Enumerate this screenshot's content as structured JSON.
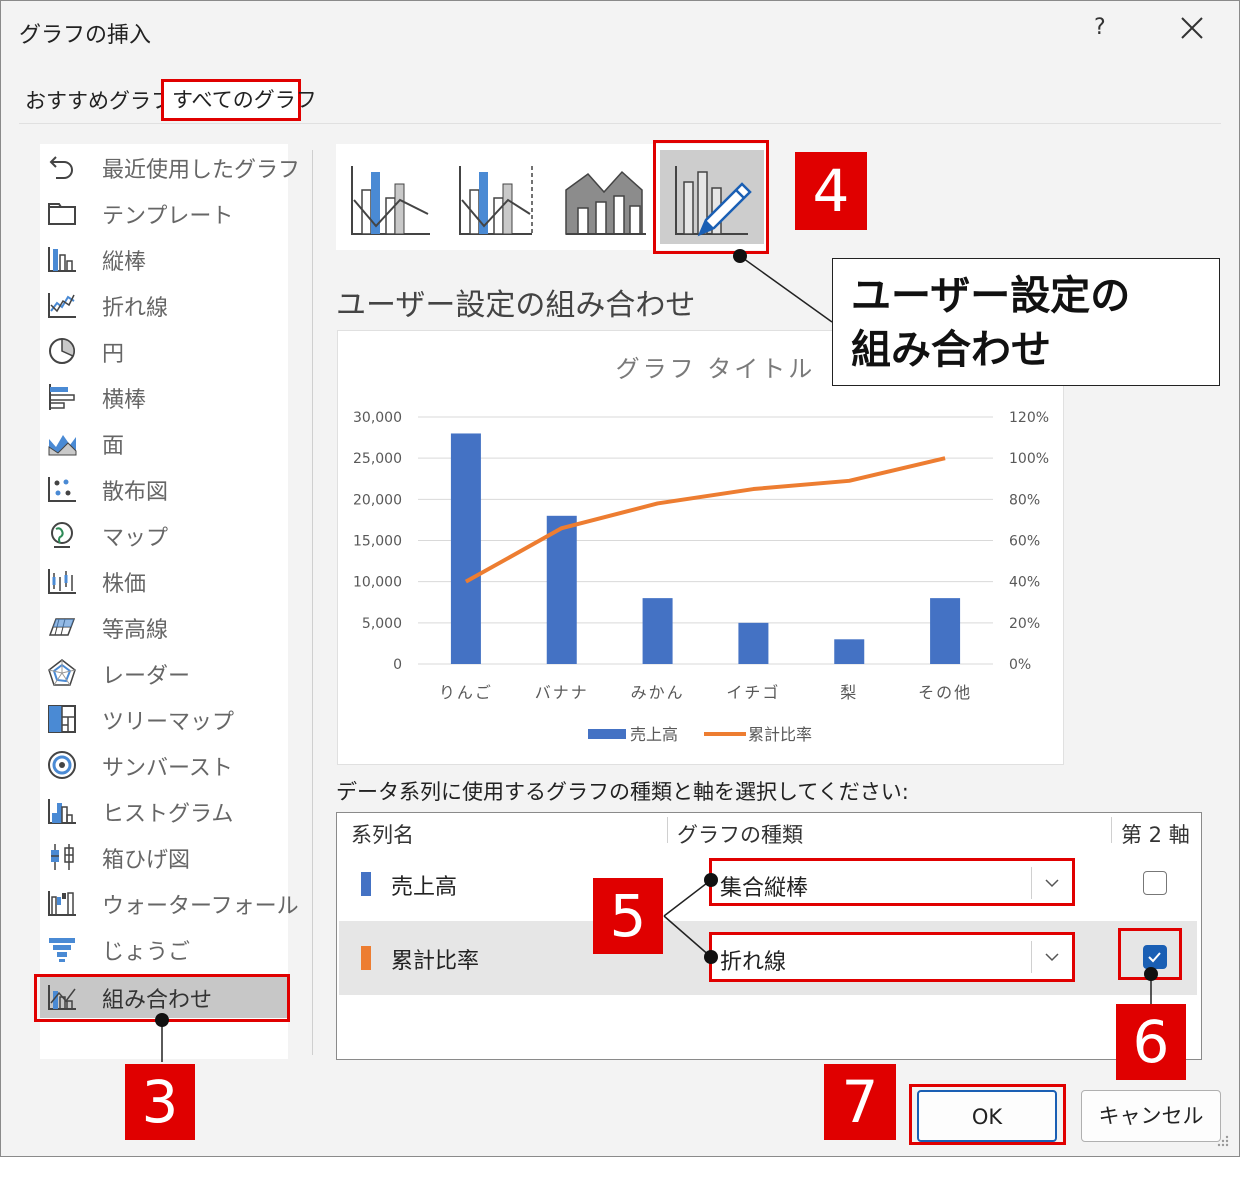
{
  "window": {
    "title": "グラフの挿入",
    "help": "?",
    "close": "✕"
  },
  "tabs": [
    {
      "label": "おすすめグラフ",
      "selected": false
    },
    {
      "label": "すべてのグラフ",
      "selected": true
    }
  ],
  "categories": [
    {
      "label": "最近使用したグラフ",
      "icon": "recent-undo-icon"
    },
    {
      "label": "テンプレート",
      "icon": "folder-icon"
    },
    {
      "label": "縦棒",
      "icon": "column-chart-icon"
    },
    {
      "label": "折れ線",
      "icon": "line-chart-icon"
    },
    {
      "label": "円",
      "icon": "pie-chart-icon"
    },
    {
      "label": "横棒",
      "icon": "bar-chart-icon"
    },
    {
      "label": "面",
      "icon": "area-chart-icon"
    },
    {
      "label": "散布図",
      "icon": "scatter-chart-icon"
    },
    {
      "label": "マップ",
      "icon": "map-globe-icon"
    },
    {
      "label": "株価",
      "icon": "stock-chart-icon"
    },
    {
      "label": "等高線",
      "icon": "surface-chart-icon"
    },
    {
      "label": "レーダー",
      "icon": "radar-chart-icon"
    },
    {
      "label": "ツリーマップ",
      "icon": "treemap-icon"
    },
    {
      "label": "サンバースト",
      "icon": "sunburst-icon"
    },
    {
      "label": "ヒストグラム",
      "icon": "histogram-icon"
    },
    {
      "label": "箱ひげ図",
      "icon": "box-whisker-icon"
    },
    {
      "label": "ウォーターフォール",
      "icon": "waterfall-icon"
    },
    {
      "label": "じょうご",
      "icon": "funnel-icon"
    },
    {
      "label": "組み合わせ",
      "icon": "combo-chart-icon",
      "selected": true
    }
  ],
  "subtitle": "ユーザー設定の組み合わせ",
  "chart_data": {
    "type": "bar",
    "title": "グラフ タイトル",
    "categories": [
      "りんご",
      "バナナ",
      "みかん",
      "イチゴ",
      "梨",
      "その他"
    ],
    "series": [
      {
        "name": "売上高",
        "type": "bar",
        "axis": "primary",
        "values": [
          28000,
          18000,
          8000,
          5000,
          3000,
          8000
        ],
        "color": "#4472c4"
      },
      {
        "name": "累計比率",
        "type": "line",
        "axis": "secondary",
        "values": [
          0.4,
          0.66,
          0.78,
          0.85,
          0.89,
          1.0
        ],
        "color": "#ed7d31"
      }
    ],
    "ylim": [
      0,
      30000
    ],
    "y_ticks": [
      "30,000",
      "25,000",
      "20,000",
      "15,000",
      "10,000",
      "5,000",
      "0"
    ],
    "y2lim": [
      0,
      1.2
    ],
    "y2_ticks": [
      "120%",
      "100%",
      "80%",
      "60%",
      "40%",
      "20%",
      "0%"
    ],
    "grid": true,
    "legend": "bottom"
  },
  "instruction": "データ系列に使用するグラフの種類と軸を選択してください:",
  "table": {
    "headers": {
      "name": "系列名",
      "type": "グラフの種類",
      "axis": "第 2 軸"
    },
    "rows": [
      {
        "name": "売上高",
        "swatch": "#4472c4",
        "chart_type": "集合縦棒",
        "secondary": false
      },
      {
        "name": "累計比率",
        "swatch": "#ed7d31",
        "chart_type": "折れ線",
        "secondary": true
      }
    ]
  },
  "buttons": {
    "ok": "OK",
    "cancel": "キャンセル"
  },
  "annotations": {
    "n3": "3",
    "n4": "4",
    "n5": "5",
    "n6": "6",
    "n7": "7",
    "callout": "ユーザー設定の\n組み合わせ"
  }
}
